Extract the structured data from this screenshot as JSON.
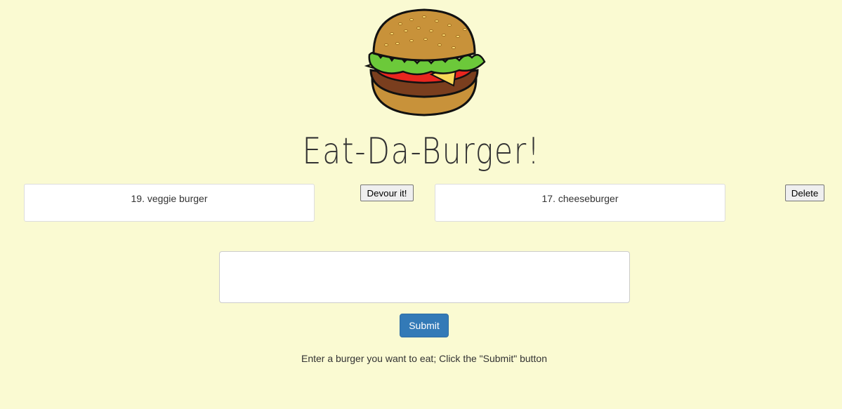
{
  "logo": {
    "icon": "hamburger-icon"
  },
  "page_title": "Eat-Da-Burger!",
  "uneaten": [
    {
      "label": "19. veggie burger",
      "button": "Devour it!"
    }
  ],
  "devoured": [
    {
      "label": "17. cheeseburger",
      "button": "Delete"
    }
  ],
  "form": {
    "textarea_value": "",
    "submit_label": "Submit"
  },
  "instructions": "Enter a burger you want to eat; Click the \"Submit\" button",
  "colors": {
    "background": "#fafad2",
    "submit_bg": "#337ab7",
    "card_bg": "#ffffff"
  }
}
